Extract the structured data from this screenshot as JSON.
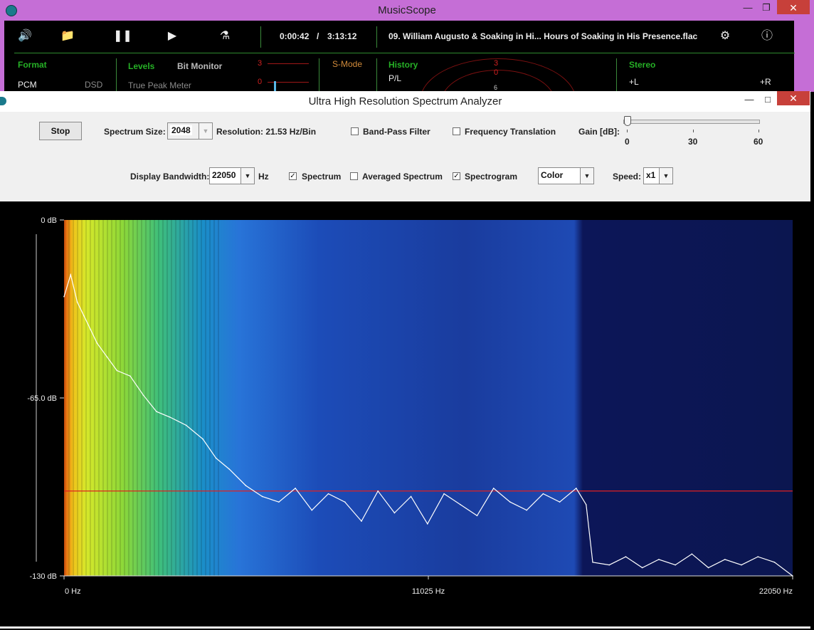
{
  "outer": {
    "title": "MusicScope",
    "time_elapsed": "0:00:42",
    "time_sep": "/",
    "time_total": "3:13:12",
    "track": "09. William Augusto & Soaking in Hi... Hours of Soaking in His Presence.flac",
    "sections": {
      "format": "Format",
      "pcm": "PCM",
      "dsd": "DSD",
      "levels": "Levels",
      "bit_monitor": "Bit Monitor",
      "true_peak": "True Peak Meter",
      "smode": "S-Mode",
      "history": "History",
      "pl": "P/L",
      "stereo": "Stereo",
      "left": "+L",
      "right": "+R",
      "lvl_3": "3",
      "lvl_0": "0",
      "hist_3": "3",
      "hist_0": "0",
      "hist_6": "6"
    }
  },
  "analyzer": {
    "title": "Ultra High Resolution Spectrum Analyzer",
    "stop_label": "Stop",
    "spectrum_size_label": "Spectrum Size:",
    "spectrum_size_value": "2048",
    "resolution": "Resolution: 21.53 Hz/Bin",
    "band_pass": {
      "label": "Band-Pass Filter",
      "checked": false
    },
    "freq_translation": {
      "label": "Frequency Translation",
      "checked": false
    },
    "gain_label": "Gain [dB]:",
    "gain_ticks": [
      "0",
      "30",
      "60"
    ],
    "gain_value": 0,
    "display_bw_label": "Display Bandwidth:",
    "display_bw_value": "22050",
    "display_bw_unit": "Hz",
    "spectrum": {
      "label": "Spectrum",
      "checked": true
    },
    "averaged": {
      "label": "Averaged Spectrum",
      "checked": false
    },
    "spectrogram": {
      "label": "Spectrogram",
      "checked": true
    },
    "color_mode": "Color",
    "speed_label": "Speed:",
    "speed_value": "x1",
    "check_mark": "✓"
  },
  "chart_data": {
    "type": "line",
    "x_unit": "Hz",
    "y_unit": "dB",
    "xlim": [
      0,
      22050
    ],
    "ylim": [
      -130,
      0
    ],
    "x_ticks": [
      "0 Hz",
      "11025 Hz",
      "22050 Hz"
    ],
    "y_ticks": [
      "0 dB",
      "-65.0 dB",
      "-130 dB"
    ],
    "reference_line_db": -99,
    "cutoff_hz": 15900,
    "series": [
      {
        "x": [
          0,
          200,
          400,
          600,
          800,
          1000,
          1300,
          1600,
          2000,
          2400,
          2800,
          3200,
          3700,
          4200,
          4600,
          5000,
          5500,
          6000,
          6500,
          7000,
          7500,
          8000,
          8500,
          9000,
          9500,
          10000,
          10500,
          11000,
          11500,
          12000,
          12500,
          13000,
          13500,
          14000,
          14500,
          15000,
          15500,
          15800,
          16000,
          16500,
          17000,
          17500,
          18000,
          18500,
          19000,
          19500,
          20000,
          20500,
          21000,
          21500,
          22050
        ],
        "y": [
          -28,
          -20,
          -30,
          -35,
          -40,
          -45,
          -50,
          -55,
          -57,
          -64,
          -70,
          -72,
          -75,
          -80,
          -87,
          -91,
          -97,
          -101,
          -103,
          -98,
          -106,
          -100,
          -103,
          -110,
          -99,
          -107,
          -101,
          -111,
          -100,
          -104,
          -108,
          -98,
          -103,
          -106,
          -100,
          -103,
          -98,
          -104,
          -125,
          -126,
          -123,
          -127,
          -124,
          -126,
          -122,
          -127,
          -124,
          -126,
          -123,
          -125,
          -130
        ]
      }
    ]
  }
}
